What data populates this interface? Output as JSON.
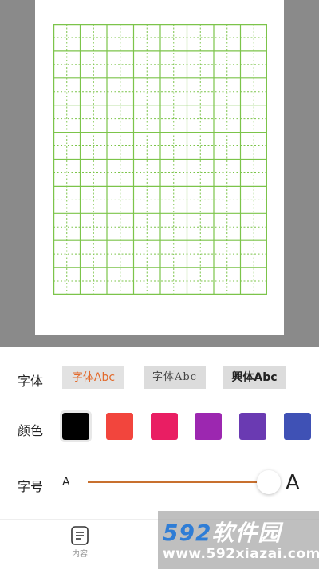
{
  "panel": {
    "font_label": "字体",
    "color_label": "颜色",
    "size_label": "字号",
    "fonts": [
      {
        "label": "字体Abc",
        "selected": true
      },
      {
        "label": "字体Abc",
        "selected": false
      },
      {
        "label": "興体Abc",
        "selected": false
      }
    ],
    "colors": [
      {
        "hex": "#000000",
        "selected": true
      },
      {
        "hex": "#f2453d",
        "selected": false
      },
      {
        "hex": "#e91e63",
        "selected": false
      },
      {
        "hex": "#9c27b0",
        "selected": false
      },
      {
        "hex": "#6a3ab2",
        "selected": false
      },
      {
        "hex": "#3f51b5",
        "selected": false
      }
    ],
    "size_small": "A",
    "size_large": "A",
    "size_level": 1.0
  },
  "grid": {
    "columns": 8,
    "rows": 10,
    "line_color": "#7cc44a"
  },
  "bottom_nav": {
    "content_label": "内容",
    "icon": "document-lines-icon"
  },
  "watermark": {
    "brand_num": "592",
    "brand_cn": "软件园",
    "url": "www.592xiazai.com"
  }
}
